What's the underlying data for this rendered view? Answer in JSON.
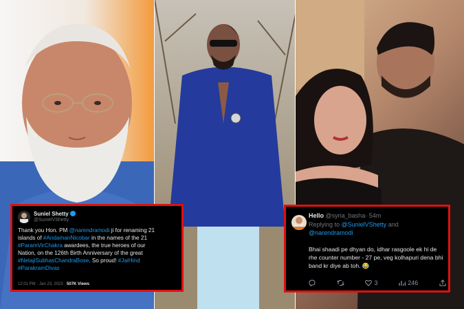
{
  "tweet1": {
    "name": "Suniel Shetty",
    "handle": "@SunielVShetty",
    "verified_icon": "verified-badge-icon",
    "body_lines": [
      [
        "Thank you Hon. PM ",
        "@narendramodi",
        " ji for renaming 21"
      ],
      [
        "islands of ",
        "#AndamanNicobar",
        " in the names of the 21"
      ],
      [
        "#ParamVirChakra",
        " awardees, the true heroes of our"
      ],
      [
        "Nation, on the 126th Birth Anniversary of the great"
      ],
      [
        "#NetajiSubhasChandraBose",
        ". So proud! ",
        "#JaiHind"
      ],
      [
        "#ParakramDivas"
      ]
    ],
    "time": "12:01 PM · Jan 23, 2023 ·",
    "views": "507K Views"
  },
  "tweet2": {
    "greeting": "Hello",
    "handle": "@syria_basha",
    "age": "· 54m",
    "replying_prefix": "Replying to ",
    "replying_to_1": "@SunielVShetty",
    "replying_and": " and",
    "replying_to_2": "@narendramodi",
    "body": "Bhai shaadi pe dhyan do, idhar rasgoole ek hi de rhe counter number - 27 pe, veg kolhapuri dena bhi band kr diye ab toh. 😂",
    "emoji_line": "😂",
    "actions": {
      "reply_icon": "reply-icon",
      "retweet_icon": "retweet-icon",
      "like_icon": "heart-icon",
      "like_count": "3",
      "views_icon": "views-icon",
      "views_count": "246",
      "share_icon": "share-icon"
    }
  },
  "colors": {
    "tweet_bg": "#000000",
    "tweet_border": "#e01010",
    "link_blue": "#1d9bf0",
    "text": "#e7e9ea",
    "muted": "#71767b"
  }
}
